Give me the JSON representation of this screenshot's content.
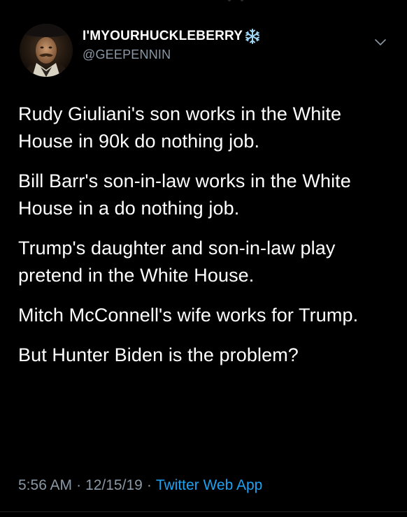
{
  "tweet": {
    "author": {
      "display_name": "I'MYOURHUCKLEBERRY",
      "emoji": "snowflake-icon",
      "handle": "@GEEPENNIN"
    },
    "paragraphs": [
      "Rudy Giuliani's son works in the White House in 90k do nothing job.",
      "Bill Barr's son-in-law works in the White House in a do nothing job.",
      "Trump's daughter and son-in-law play pretend in the White House.",
      "Mitch McConnell's wife works for Trump.",
      "But Hunter Biden is the problem?"
    ],
    "time": "5:56 AM",
    "separator": "·",
    "date": "12/15/19",
    "source": "Twitter Web App"
  },
  "colors": {
    "background": "#000000",
    "text": "#ffffff",
    "secondary": "#8b98a5",
    "link": "#1da1f2",
    "snowflake": "#9fd8f5"
  }
}
